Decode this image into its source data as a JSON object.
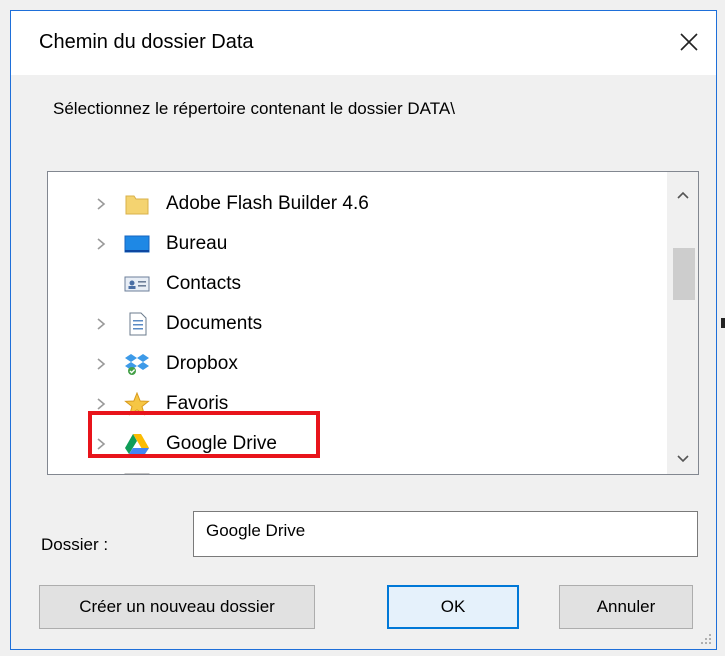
{
  "window": {
    "title": "Chemin du dossier Data",
    "close_icon": "close-icon"
  },
  "instruction": "Sélectionnez le répertoire contenant le dossier DATA\\",
  "tree": {
    "items": [
      {
        "label": "Adobe Flash Builder 4.6",
        "icon": "folder-icon",
        "expandable": true
      },
      {
        "label": "Bureau",
        "icon": "desktop-icon",
        "expandable": true
      },
      {
        "label": "Contacts",
        "icon": "contacts-icon",
        "expandable": false
      },
      {
        "label": "Documents",
        "icon": "documents-icon",
        "expandable": true
      },
      {
        "label": "Dropbox",
        "icon": "dropbox-icon",
        "expandable": true
      },
      {
        "label": "Favoris",
        "icon": "star-icon",
        "expandable": true
      },
      {
        "label": "Google Drive",
        "icon": "google-drive-icon",
        "expandable": true,
        "highlighted": true
      }
    ]
  },
  "folder": {
    "label": "Dossier :",
    "value": "Google Drive"
  },
  "buttons": {
    "new_folder": "Créer un nouveau dossier",
    "ok": "OK",
    "cancel": "Annuler"
  },
  "colors": {
    "highlight": "#e8141b",
    "accent": "#0078d7",
    "window_border": "#1e6fd9"
  }
}
